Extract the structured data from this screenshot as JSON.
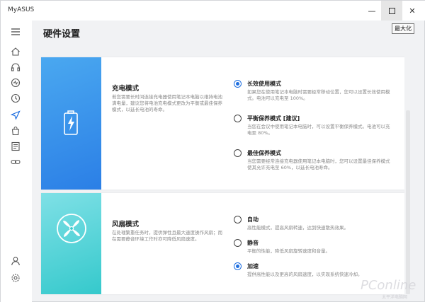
{
  "window": {
    "app_title": "MyASUS",
    "minimize_glyph": "—",
    "close_glyph": "✕",
    "tooltip": "最大化"
  },
  "sidebar": {
    "items": [
      {
        "icon": "hamburger-menu-icon"
      },
      {
        "icon": "home-icon"
      },
      {
        "icon": "headset-icon"
      },
      {
        "icon": "diagnosis-icon"
      },
      {
        "icon": "system-update-icon"
      },
      {
        "icon": "customization-icon"
      },
      {
        "icon": "store-icon"
      },
      {
        "icon": "news-icon"
      },
      {
        "icon": "link-icon"
      },
      {
        "icon": "account-icon"
      },
      {
        "icon": "settings-icon"
      }
    ],
    "active_index": 4,
    "active_color": "#1f6fe0"
  },
  "page": {
    "title": "硬件设置"
  },
  "charging": {
    "title": "充电模式",
    "description": "若您需要长时间连接充电器使用笔记本电脑以维持电池满电量，建议您将电池充电模式更改为平衡或最佳保养模式，以延长电池的寿命。",
    "options": [
      {
        "label": "长效使用模式",
        "desc": "如果您在使用笔记本电脑时需要经常移动位置，您可以设置长效使用模式。电池可以充电至 100%。",
        "selected": true
      },
      {
        "label": "平衡保养模式 [建议]",
        "desc": "当您在会议中使用笔记本电脑时，可以设置平衡保养模式。电池可以充电至 80%。",
        "selected": false
      },
      {
        "label": "最佳保养模式",
        "desc": "当您需要经常连接充电器使用笔记本电脑时，您可以设置最佳保养模式使其允许充电至 60%，以延长电池寿命。",
        "selected": false
      }
    ],
    "accent": "#2b7fe6"
  },
  "fan": {
    "title": "风扇模式",
    "description": "在处理繁重任务时，提供弹性且最大速度操作风扇；而在需要静音环境工作时亦可降低风扇速度。",
    "options": [
      {
        "label": "自动",
        "desc": "高性能模式，提高风扇转速，达到快速散热效果。",
        "selected": false
      },
      {
        "label": "静音",
        "desc": "平衡的性能，降低风扇旋转速度和音量。",
        "selected": false
      },
      {
        "label": "加速",
        "desc": "提供高性能以及更高的风扇速度，以实现系统快速冷却。",
        "selected": true
      }
    ],
    "accent": "#35c9cc"
  },
  "watermark": {
    "brand": "PConline",
    "sub": "太平洋电脑网"
  }
}
